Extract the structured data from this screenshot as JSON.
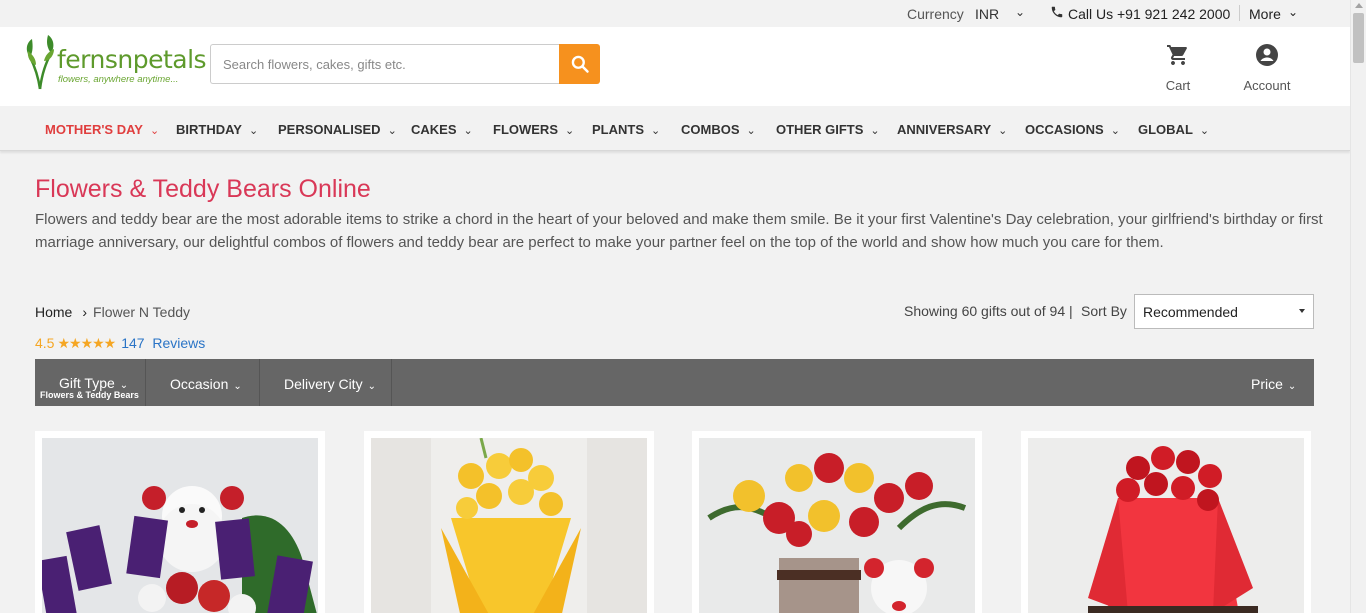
{
  "topbar": {
    "currency_label": "Currency",
    "currency_value": "INR",
    "call_text": "Call Us +91 921 242 2000",
    "more_label": "More"
  },
  "header": {
    "logo_word": "fernsnpetals",
    "logo_tagline": "flowers, anywhere anytime...",
    "search_placeholder": "Search flowers, cakes, gifts etc.",
    "cart_label": "Cart",
    "account_label": "Account"
  },
  "nav": {
    "items": [
      {
        "label": "MOTHER'S DAY"
      },
      {
        "label": "BIRTHDAY"
      },
      {
        "label": "PERSONALISED"
      },
      {
        "label": "CAKES"
      },
      {
        "label": "FLOWERS"
      },
      {
        "label": "PLANTS"
      },
      {
        "label": "COMBOS"
      },
      {
        "label": "OTHER GIFTS"
      },
      {
        "label": "ANNIVERSARY"
      },
      {
        "label": "OCCASIONS"
      },
      {
        "label": "GLOBAL"
      }
    ]
  },
  "page": {
    "title": "Flowers & Teddy Bears Online",
    "description": "Flowers and teddy bear are the most adorable items to strike a chord in the heart of your beloved and make them smile. Be it your first Valentine's Day celebration, your girlfriend's birthday or first marriage anniversary, our delightful combos of flowers and teddy bear are perfect to make your partner feel on the top of the world and show how much you care for them."
  },
  "breadcrumb": {
    "home": "Home",
    "current": "Flower N Teddy"
  },
  "rating": {
    "score": "4.5",
    "stars": "★★★★★",
    "review_count": "147",
    "reviews_label": "Reviews"
  },
  "results": {
    "showing_text": "Showing 60 gifts out of 94 |",
    "sort_label": "Sort By",
    "sort_selected": "Recommended"
  },
  "filters": {
    "gift_type": {
      "label": "Gift Type",
      "selected": "Flowers & Teddy Bears"
    },
    "occasion": {
      "label": "Occasion"
    },
    "delivery_city": {
      "label": "Delivery City"
    },
    "price": {
      "label": "Price"
    }
  },
  "colors": {
    "accent_orange": "#f6911e",
    "title_red": "#d93857",
    "active_nav": "#e03e3e",
    "filter_bar": "#666666",
    "brand_green": "#5e9a2c"
  }
}
